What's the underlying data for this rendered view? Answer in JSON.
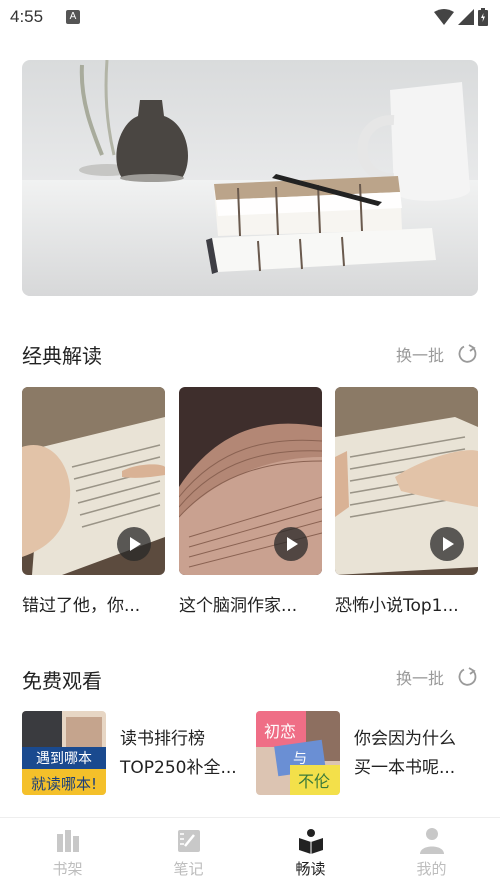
{
  "status": {
    "time": "4:55",
    "a_icon": "A"
  },
  "section_classic": {
    "title": "经典解读",
    "swap_label": "换一批"
  },
  "classic_cards": [
    {
      "caption": "错过了他，你..."
    },
    {
      "caption": "这个脑洞作家..."
    },
    {
      "caption": "恐怖小说Top1..."
    }
  ],
  "section_free": {
    "title": "免费观看",
    "swap_label": "换一批"
  },
  "free_items": [
    {
      "line1": "读书排行榜",
      "line2": "TOP250补全...",
      "thumb_text1": "遇到哪本",
      "thumb_text2": "就读哪本!"
    },
    {
      "line1": "你会因为什么",
      "line2": "买一本书呢...",
      "thumb_text1": "初恋",
      "thumb_text2": "与",
      "thumb_text3": "不伦"
    }
  ],
  "tabs": [
    {
      "label": "书架",
      "icon": "bookshelf-icon"
    },
    {
      "label": "笔记",
      "icon": "notes-icon"
    },
    {
      "label": "畅读",
      "icon": "reading-icon",
      "active": true
    },
    {
      "label": "我的",
      "icon": "profile-icon"
    }
  ],
  "colors": {
    "active": "#222222",
    "inactive": "#bdbdbd",
    "secondary": "#9a9a9a"
  }
}
